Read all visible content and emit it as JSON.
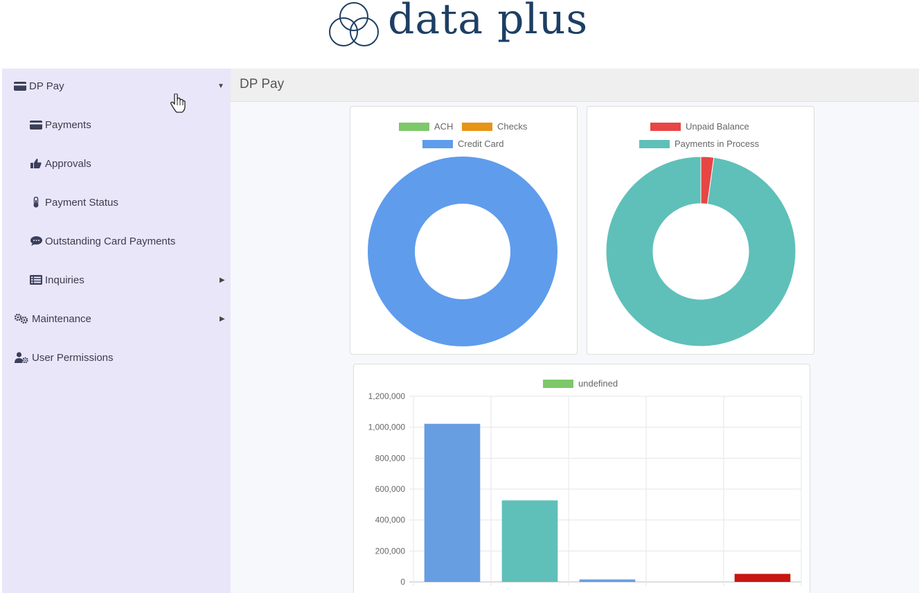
{
  "brand": {
    "name": "data plus",
    "color": "#1d3f63"
  },
  "sidebar": {
    "items": [
      {
        "label": "DP Pay",
        "icon": "credit-card-icon",
        "level": 1,
        "arrow": "caret-down"
      },
      {
        "label": "Payments",
        "icon": "credit-card-icon",
        "level": 2
      },
      {
        "label": "Approvals",
        "icon": "thumbs-up-icon",
        "level": 2
      },
      {
        "label": "Payment Status",
        "icon": "thermometer-icon",
        "level": 2
      },
      {
        "label": "Outstanding Card Payments",
        "icon": "comment-icon",
        "level": 2
      },
      {
        "label": "Inquiries",
        "icon": "list-icon",
        "level": 2,
        "arrow": "caret-right"
      },
      {
        "label": "Maintenance",
        "icon": "cogs-icon",
        "level": 1,
        "arrow": "caret-right"
      },
      {
        "label": "User Permissions",
        "icon": "user-cog-icon",
        "level": 1
      }
    ]
  },
  "content": {
    "title": "DP Pay"
  },
  "chart_data": [
    {
      "type": "pie",
      "subtype": "doughnut",
      "legend": [
        {
          "name": "ACH",
          "color": "#7dc86a"
        },
        {
          "name": "Checks",
          "color": "#e89414"
        },
        {
          "name": "Credit Card",
          "color": "#5f9cec"
        }
      ],
      "values": [
        0,
        0,
        100
      ],
      "legend_position": "top"
    },
    {
      "type": "pie",
      "subtype": "doughnut",
      "legend": [
        {
          "name": "Unpaid Balance",
          "color": "#e84545"
        },
        {
          "name": "Payments in Process",
          "color": "#5fc0b9"
        }
      ],
      "values": [
        2.2,
        97.8
      ],
      "legend_position": "top"
    },
    {
      "type": "bar",
      "legend": [
        {
          "name": "undefined",
          "color": "#7dc86a"
        }
      ],
      "ylim": [
        0,
        1200000
      ],
      "yticks": [
        "1,200,000",
        "1,000,000",
        "800,000",
        "600,000",
        "400,000",
        "200,000",
        "0"
      ],
      "values": [
        1022000,
        527000,
        16000,
        0,
        52000
      ],
      "colors": [
        "#679ee1",
        "#5fc0b9",
        "#679ee1",
        "#679ee1",
        "#c81612"
      ],
      "grid": true,
      "legend_position": "top"
    }
  ]
}
